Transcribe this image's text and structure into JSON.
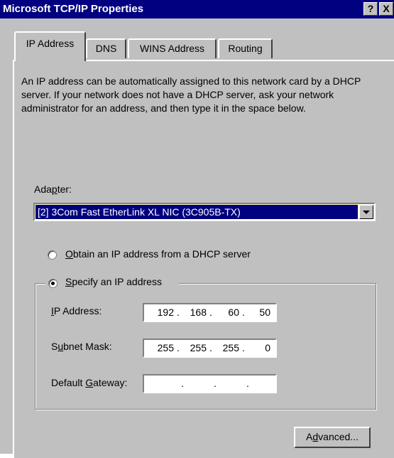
{
  "window": {
    "title": "Microsoft TCP/IP Properties",
    "help_label": "?",
    "close_label": "X"
  },
  "tabs": [
    {
      "label": "IP Address",
      "active": true
    },
    {
      "label": "DNS",
      "active": false
    },
    {
      "label": "WINS Address",
      "active": false
    },
    {
      "label": "Routing",
      "active": false
    }
  ],
  "description": "An IP address can be automatically assigned to this network card by a DHCP server.  If your network does not have a DHCP server, ask your network administrator for an address, and then type it in the space below.",
  "adapter": {
    "label_pre": "Ada",
    "label_key": "p",
    "label_post": "ter:",
    "selected": "[2] 3Com Fast EtherLink XL NIC (3C905B-TX)"
  },
  "options": {
    "dhcp": {
      "key": "O",
      "rest": "btain an IP address from a DHCP server",
      "checked": false
    },
    "specify": {
      "key": "S",
      "rest": "pecify an IP address",
      "checked": true
    }
  },
  "fields": {
    "ip": {
      "label_key": "I",
      "label_rest": "P Address:",
      "octets": [
        "192",
        "168",
        "60",
        "50"
      ]
    },
    "subnet": {
      "label_pre": "S",
      "label_key": "u",
      "label_rest": "bnet Mask:",
      "octets": [
        "255",
        "255",
        "255",
        "0"
      ]
    },
    "gateway": {
      "label_pre": "Default ",
      "label_key": "G",
      "label_rest": "ateway:",
      "octets": [
        "",
        "",
        "",
        ""
      ]
    }
  },
  "advanced_button": {
    "pre": "A",
    "key": "d",
    "post": "vanced..."
  },
  "dot": "."
}
